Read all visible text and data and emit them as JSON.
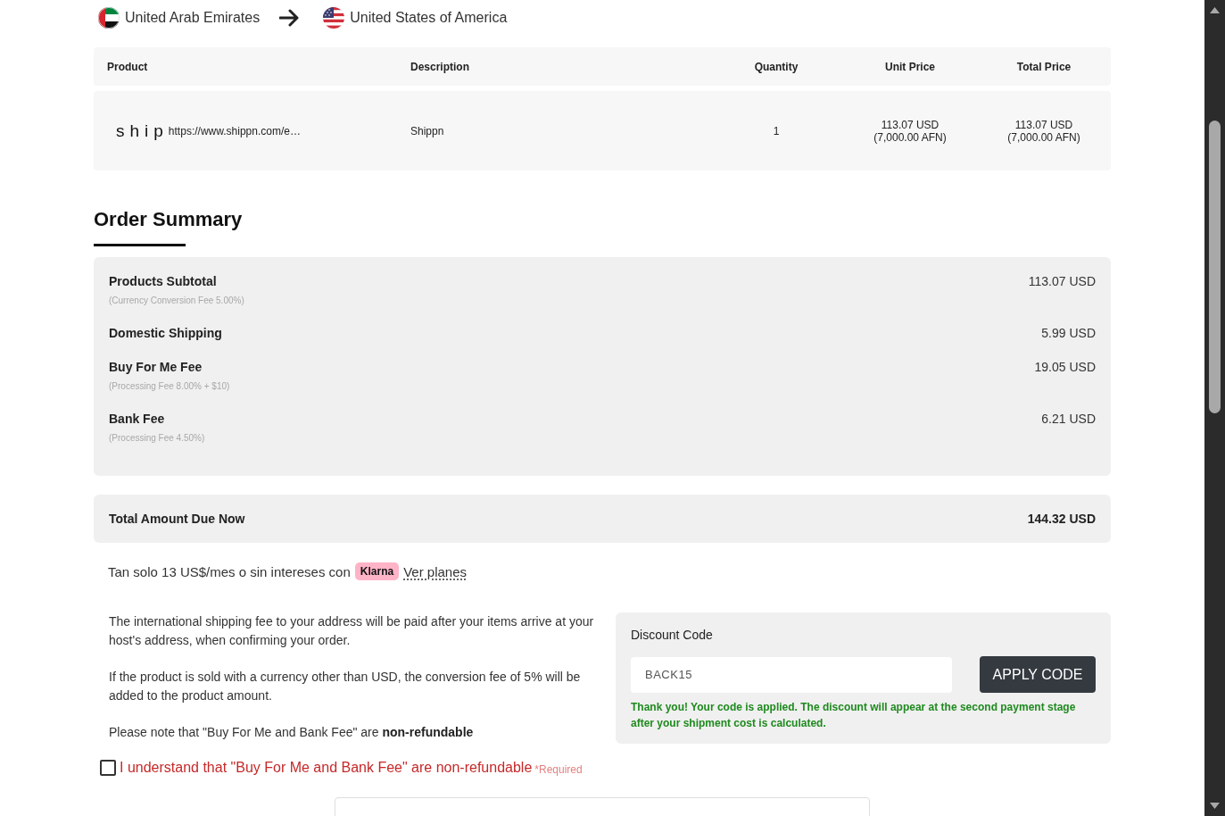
{
  "route": {
    "from": "United Arab Emirates",
    "to": "United States of America"
  },
  "products_table": {
    "columns": [
      "Product",
      "Description",
      "Quantity",
      "Unit Price",
      "Total Price"
    ],
    "rows": [
      {
        "product_logo": "ship",
        "product_link": "https://www.shippn.com/e…",
        "description": "Shippn",
        "quantity": "1",
        "unit_price": {
          "amount": "113.07 USD",
          "converted": "(7,000.00 AFN)"
        },
        "total_price": {
          "amount": "113.07 USD",
          "converted": "(7,000.00 AFN)"
        }
      }
    ]
  },
  "order_summary": {
    "title": "Order Summary",
    "items": [
      {
        "label": "Products Subtotal",
        "note": "(Currency Conversion Fee 5.00%)",
        "value": "113.07 USD"
      },
      {
        "label": "Domestic Shipping",
        "value": "5.99 USD"
      },
      {
        "label": "Buy For Me Fee",
        "note": "(Processing Fee 8.00% + $10)",
        "value": "19.05 USD"
      },
      {
        "label": "Bank Fee",
        "note": "(Processing Fee 4.50%)",
        "value": "6.21 USD"
      }
    ],
    "total": {
      "label": "Total Amount Due Now",
      "value": "144.32 USD"
    }
  },
  "installments": {
    "text": "Tan solo 13 US$/mes o sin intereses con",
    "badge": "Klarna",
    "link": "Ver planes"
  },
  "notes": [
    "The international shipping fee to your address will be paid after your items arrive at your host's address, when confirming your order.",
    "If the product is sold with a currency other than USD, the conversion fee of 5% will be added to the product amount.",
    "Please note that \"Buy For Me and Bank Fee\" are **non-refundable**"
  ],
  "discount": {
    "label": "Discount Code",
    "value": "BACK15",
    "button": "APPLY CODE",
    "message": "Thank you! Your code is applied. The discount will appear at the second payment stage after your shipment cost is calculated."
  },
  "agreement": {
    "checked": false,
    "label": "I understand that \"Buy For Me and Bank Fee\" are non-refundable",
    "required_note": "*Required"
  }
}
